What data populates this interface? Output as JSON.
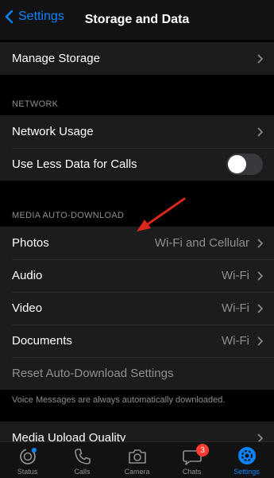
{
  "nav": {
    "back_label": "Settings",
    "title": "Storage and Data"
  },
  "storage": {
    "manage_label": "Manage Storage"
  },
  "network": {
    "header": "NETWORK",
    "usage_label": "Network Usage",
    "less_data_label": "Use Less Data for Calls",
    "less_data_on": false
  },
  "media": {
    "header": "MEDIA AUTO-DOWNLOAD",
    "rows": [
      {
        "label": "Photos",
        "value": "Wi-Fi and Cellular"
      },
      {
        "label": "Audio",
        "value": "Wi-Fi"
      },
      {
        "label": "Video",
        "value": "Wi-Fi"
      },
      {
        "label": "Documents",
        "value": "Wi-Fi"
      }
    ],
    "reset_label": "Reset Auto-Download Settings",
    "footnote": "Voice Messages are always automatically downloaded."
  },
  "upload": {
    "label": "Media Upload Quality"
  },
  "tabs": [
    {
      "label": "Status",
      "icon": "status-icon"
    },
    {
      "label": "Calls",
      "icon": "phone-icon"
    },
    {
      "label": "Camera",
      "icon": "camera-icon"
    },
    {
      "label": "Chats",
      "icon": "chat-icon",
      "badge": "3"
    },
    {
      "label": "Settings",
      "icon": "gear-icon",
      "active": true
    }
  ],
  "colors": {
    "accent": "#0a84ff",
    "badge": "#ff3b30",
    "annotation_arrow": "#d9281c"
  }
}
